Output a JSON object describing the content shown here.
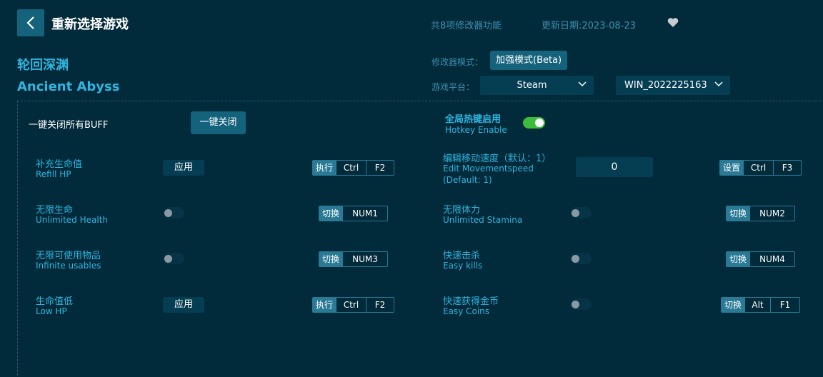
{
  "header": {
    "title": "重新选择游戏",
    "feature_count": "共8项修改器功能",
    "update_date": "更新日期:2023-08-23"
  },
  "game": {
    "name_cn": "轮回深渊",
    "name_en": "Ancient Abyss"
  },
  "settings": {
    "mode_label": "修改器模式：",
    "mode_value": "加强模式(Beta)",
    "platform_label": "游戏平台：",
    "platform_value": "Steam",
    "version_value": "WIN_20222251​63"
  },
  "top": {
    "buff_label": "一键关闭所有BUFF",
    "onekey_button": "一键关闭",
    "hotkey_cn": "全局热键启用",
    "hotkey_en": "Hotkey Enable"
  },
  "features": {
    "f1": {
      "cn": "补充生命值",
      "en": "Refill HP",
      "control": "应用",
      "tag": "执行",
      "k1": "Ctrl",
      "k2": "F2"
    },
    "f2": {
      "cn": "编辑移动速度（默认：1）",
      "en": "Edit Movementspeed",
      "en2": "(Default: 1)",
      "value": "0",
      "tag": "设置",
      "k1": "Ctrl",
      "k2": "F3"
    },
    "f3": {
      "cn": "无限生命",
      "en": "Unlimited Health",
      "tag": "切换",
      "k1": "NUM1"
    },
    "f4": {
      "cn": "无限体力",
      "en": "Unlimited Stamina",
      "tag": "切换",
      "k1": "NUM2"
    },
    "f5": {
      "cn": "无限可使用物品",
      "en": "Infinite usables",
      "tag": "切换",
      "k1": "NUM3"
    },
    "f6": {
      "cn": "快速击杀",
      "en": "Easy kills",
      "tag": "切换",
      "k1": "NUM4"
    },
    "f7": {
      "cn": "生命值低",
      "en": "Low HP",
      "control": "应用",
      "tag": "执行",
      "k1": "Ctrl",
      "k2": "F2"
    },
    "f8": {
      "cn": "快速获得金币",
      "en": "Easy Coins",
      "tag": "切换",
      "k1": "Alt",
      "k2": "F1"
    }
  },
  "colors": {
    "background": "#012a3a",
    "accent": "#2fb5e0",
    "button": "#15627c",
    "toggle_on": "#3dbb3d"
  },
  "icons": [
    "back-arrow-icon",
    "heart-icon",
    "chevron-down-icon"
  ]
}
